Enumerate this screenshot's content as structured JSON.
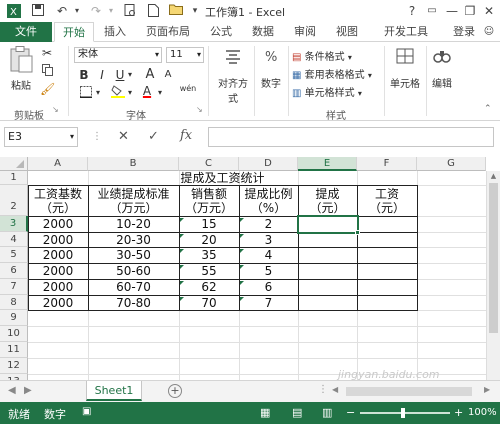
{
  "titlebar": {
    "title": "工作簿1 - Excel",
    "help": "?",
    "minimize": "—",
    "restore": "❐",
    "close": "✕"
  },
  "tabs": {
    "file": "文件",
    "items": [
      "开始",
      "插入",
      "页面布局",
      "公式",
      "数据",
      "审阅",
      "视图",
      "开发工具"
    ],
    "login": "登录"
  },
  "ribbon": {
    "clipboard": {
      "paste": "粘贴",
      "label": "剪贴板"
    },
    "font": {
      "name": "宋体",
      "size": "11",
      "bold": "B",
      "italic": "I",
      "underline": "U",
      "grow": "A",
      "shrink": "A",
      "font_color": "A",
      "phonetic": "wén",
      "label": "字体"
    },
    "alignment": {
      "label": "对齐方式"
    },
    "number": {
      "label": "数字"
    },
    "styles": {
      "conditional": "条件格式",
      "table": "套用表格格式",
      "cell": "单元格样式",
      "label": "样式"
    },
    "cells": {
      "label": "单元格"
    },
    "editing": {
      "label": "编辑"
    }
  },
  "formula_bar": {
    "namebox": "E3",
    "cancel": "✕",
    "enter": "✓",
    "fx": "fx",
    "value": ""
  },
  "columns": [
    "A",
    "B",
    "C",
    "D",
    "E",
    "F",
    "G"
  ],
  "rows": [
    "1",
    "2",
    "3",
    "4",
    "5",
    "6",
    "7",
    "8",
    "9",
    "10",
    "11",
    "12",
    "13"
  ],
  "sheet": {
    "title": "提成及工资统计",
    "headers": [
      {
        "line1": "工资基数",
        "line2": "（元）"
      },
      {
        "line1": "业绩提成标准",
        "line2": "（万元）"
      },
      {
        "line1": "销售额",
        "line2": "（万元）"
      },
      {
        "line1": "提成比例",
        "line2": "（%）"
      },
      {
        "line1": "提成",
        "line2": "（元）"
      },
      {
        "line1": "工资",
        "line2": "（元）"
      }
    ],
    "data": [
      [
        "2000",
        "10-20",
        "15",
        "2"
      ],
      [
        "2000",
        "20-30",
        "20",
        "3"
      ],
      [
        "2000",
        "30-50",
        "35",
        "4"
      ],
      [
        "2000",
        "50-60",
        "55",
        "5"
      ],
      [
        "2000",
        "60-70",
        "62",
        "6"
      ],
      [
        "2000",
        "70-80",
        "70",
        "7"
      ]
    ]
  },
  "sheet_tabs": {
    "active": "Sheet1",
    "add": "+"
  },
  "status": {
    "ready": "就绪",
    "numlock": "数字",
    "zoom": "100%",
    "watermark": "jingyan.baidu.com"
  },
  "colors": {
    "accent": "#217346"
  }
}
